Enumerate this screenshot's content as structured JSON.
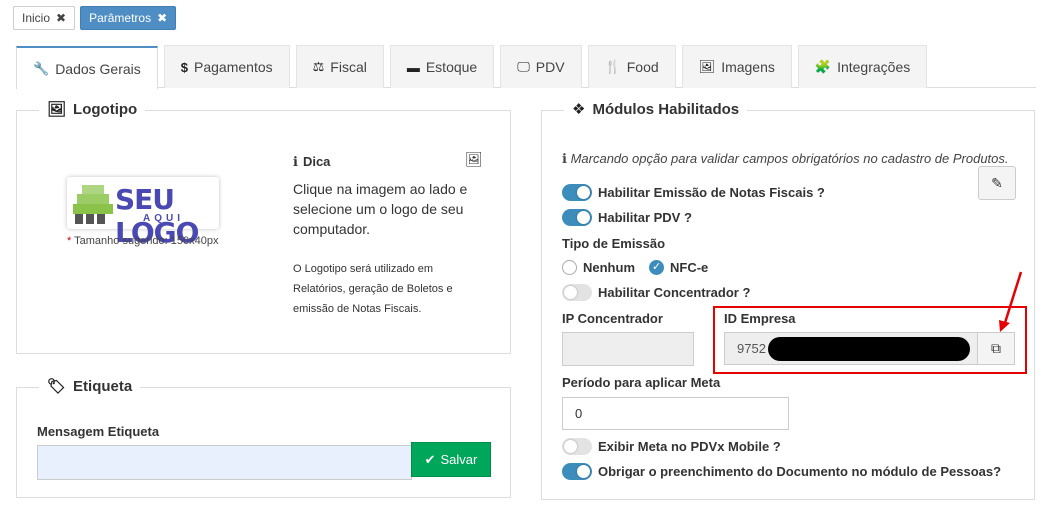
{
  "page_tabs": [
    {
      "label": "Inicio",
      "close": "✖"
    },
    {
      "label": "Parâmetros",
      "close": "✖"
    }
  ],
  "module_tabs": [
    {
      "label": "Dados Gerais",
      "icon": "wrench-icon",
      "glyph": "🔧"
    },
    {
      "label": "Pagamentos",
      "icon": "dollar-icon",
      "glyph": "$"
    },
    {
      "label": "Fiscal",
      "icon": "balance-scale-icon",
      "glyph": "⚖"
    },
    {
      "label": "Estoque",
      "icon": "archive-icon",
      "glyph": "▬"
    },
    {
      "label": "PDV",
      "icon": "monitor-icon",
      "glyph": "🖵"
    },
    {
      "label": "Food",
      "icon": "utensils-icon",
      "glyph": "🍴"
    },
    {
      "label": "Imagens",
      "icon": "image-icon",
      "glyph": "🖼"
    },
    {
      "label": "Integrações",
      "icon": "puzzle-icon",
      "glyph": "🧩"
    }
  ],
  "logotipo": {
    "legend": "Logotipo",
    "logo_main": "SEU LOGO",
    "logo_sub": "AQUI",
    "hint_required": "*",
    "hint": " Tamanho sugerido: 150x40px",
    "dica_title": "Dica",
    "dica_text": "Clique na imagem ao lado e selecione um o logo de seu computador.",
    "dica_small": "O Logotipo será utilizado em Relatórios, geração de Boletos e emissão de Notas Fiscais."
  },
  "etiqueta": {
    "legend": "Etiqueta",
    "field_label": "Mensagem Etiqueta",
    "field_value": "",
    "save_label": "Salvar"
  },
  "modulos": {
    "legend": "Módulos Habilitados",
    "info": "Marcando opção para validar campos obrigatórios no cadastro de Produtos.",
    "toggle_nf": "Habilitar Emissão de Notas Fiscais ?",
    "toggle_pdv": "Habilitar PDV ?",
    "tipo_emissao_label": "Tipo de Emissão",
    "radio_nenhum": "Nenhum",
    "radio_nfce": "NFC-e",
    "toggle_concentrador": "Habilitar Concentrador ?",
    "ip_label": "IP Concentrador",
    "ip_value": "",
    "id_label": "ID Empresa",
    "id_value": "9752",
    "periodo_label": "Período para aplicar Meta",
    "periodo_value": "0",
    "toggle_meta": "Exibir Meta no PDVx Mobile ?",
    "toggle_documento": "Obrigar o preenchimento do Documento no módulo de Pessoas?"
  },
  "colors": {
    "accent": "#4f8ec4",
    "success": "#00a65a",
    "toggle_on": "#3c8dbc",
    "highlight": "#e60000"
  }
}
